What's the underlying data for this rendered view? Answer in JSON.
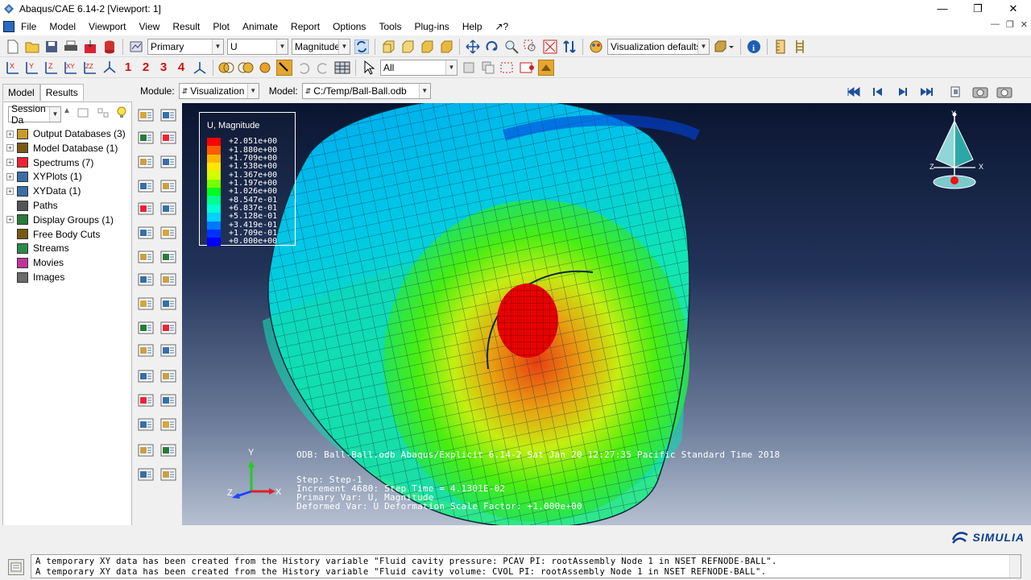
{
  "window": {
    "title": "Abaqus/CAE 6.14-2 [Viewport: 1]"
  },
  "menu": [
    "File",
    "Model",
    "Viewport",
    "View",
    "Result",
    "Plot",
    "Animate",
    "Report",
    "Options",
    "Tools",
    "Plug-ins",
    "Help",
    "↗?"
  ],
  "toolbar1": {
    "step_combo": "Primary",
    "var_combo": "U",
    "comp_combo": "Magnitude",
    "vis_combo": "Visualization defaults"
  },
  "toolbar2": {
    "numbers": [
      "1",
      "2",
      "3",
      "4"
    ],
    "select_combo": "All"
  },
  "context": {
    "module_label": "Module:",
    "module_value": "Visualization",
    "model_label": "Model:",
    "model_value": "C:/Temp/Ball-Ball.odb"
  },
  "left_panel": {
    "tabs": [
      "Model",
      "Results"
    ],
    "active_tab": "Results",
    "session_combo": "Session Da",
    "tree": [
      {
        "label": "Output Databases (3)",
        "icon": "database-icon",
        "expandable": true
      },
      {
        "label": "Model Database (1)",
        "icon": "model-database-icon",
        "expandable": true
      },
      {
        "label": "Spectrums (7)",
        "icon": "spectrum-icon",
        "expandable": true
      },
      {
        "label": "XYPlots (1)",
        "icon": "xyplot-icon",
        "expandable": true
      },
      {
        "label": "XYData (1)",
        "icon": "xydata-icon",
        "expandable": true
      },
      {
        "label": "Paths",
        "icon": "path-icon",
        "expandable": false
      },
      {
        "label": "Display Groups (1)",
        "icon": "display-group-icon",
        "expandable": true
      },
      {
        "label": "Free Body Cuts",
        "icon": "free-body-icon",
        "expandable": false
      },
      {
        "label": "Streams",
        "icon": "streams-icon",
        "expandable": false
      },
      {
        "label": "Movies",
        "icon": "movies-icon",
        "expandable": false
      },
      {
        "label": "Images",
        "icon": "images-icon",
        "expandable": false
      }
    ]
  },
  "legend": {
    "title": "U, Magnitude",
    "values": [
      "+2.051e+00",
      "+1.880e+00",
      "+1.709e+00",
      "+1.538e+00",
      "+1.367e+00",
      "+1.197e+00",
      "+1.026e+00",
      "+8.547e-01",
      "+6.837e-01",
      "+5.128e-01",
      "+3.419e-01",
      "+1.709e-01",
      "+0.000e+00"
    ],
    "colors": [
      "#ff0000",
      "#ff5a00",
      "#ffb400",
      "#ffe600",
      "#d2ff00",
      "#78ff00",
      "#00ff1e",
      "#00ff8c",
      "#00ffd2",
      "#00d2ff",
      "#0078ff",
      "#0032ff",
      "#0000ff"
    ]
  },
  "viewport_info": {
    "odb_line": "ODB: Ball-Ball.odb    Abaqus/Explicit 6.14-2    Sat Jan 20 12:27:35 Pacific Standard Time 2018",
    "step_line": "Step: Step-1",
    "increment_line": "Increment    4680: Step Time =    4.1301E-02",
    "primary_line": "Primary Var: U, Magnitude",
    "deformed_line": "Deformed Var: U   Deformation Scale Factor: +1.000e+00"
  },
  "triad": {
    "x": "X",
    "y": "Y",
    "z": "Z"
  },
  "brand": "SIMULIA",
  "messages": [
    "A temporary XY data has been created from the History variable \"Fluid cavity pressure: PCAV PI: rootAssembly Node 1 in NSET REFNODE-BALL\".",
    "A temporary XY data has been created from the History variable \"Fluid cavity volume: CVOL PI: rootAssembly Node 1 in NSET REFNODE-BALL\"."
  ]
}
